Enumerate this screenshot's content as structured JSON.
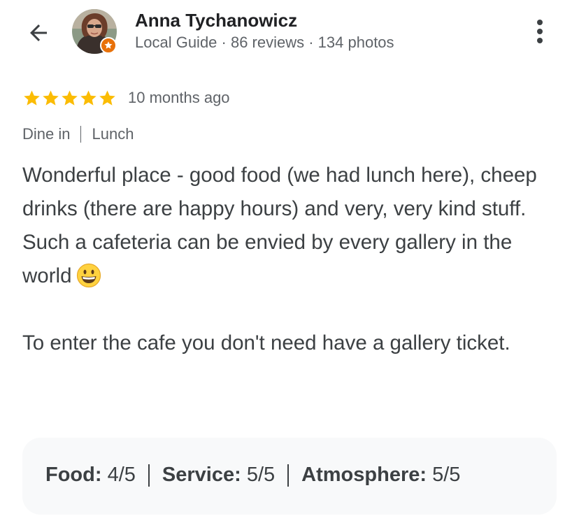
{
  "header": {
    "back_icon": "arrow-back-icon",
    "more_icon": "more-vert-icon",
    "author_name": "Anna Tychanowicz",
    "author_meta": "Local Guide · 86 reviews · 134 photos",
    "badge_icon": "local-guide-star-icon",
    "badge_color": "#e8710a"
  },
  "review": {
    "star_color": "#fbbc04",
    "rating": 5,
    "max_rating": 5,
    "time": "10 months ago",
    "tags": [
      "Dine in",
      "Lunch"
    ],
    "paragraphs": [
      "Wonderful place - good food (we had lunch here), cheep drinks (there are happy hours) and very, very kind stuff.",
      "Such a cafeteria can be envied by every gallery in the world",
      "",
      "To enter the cafe you don't need have a gallery ticket."
    ],
    "emoji": "grinning-face-emoji"
  },
  "ratings": {
    "food_label": "Food:",
    "food_value": "4/5",
    "service_label": "Service:",
    "service_value": "5/5",
    "atmosphere_label": "Atmosphere:",
    "atmosphere_value": "5/5"
  }
}
